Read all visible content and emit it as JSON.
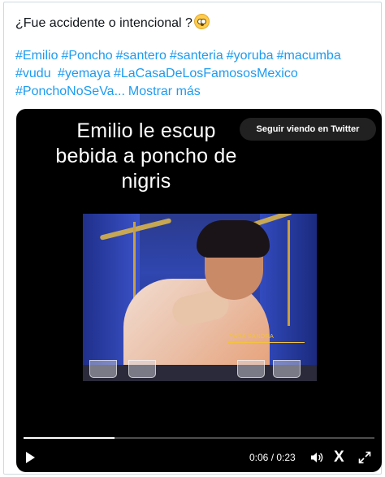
{
  "tweet": {
    "text": "¿Fue accidente o intencional ?",
    "emoji": "flushed-face-emoji",
    "hashtags": [
      "#Emilio",
      "#Poncho",
      "#santero",
      "#santeria",
      "#yoruba",
      "#macumba",
      "#vudu",
      " #yemaya",
      "#LaCasaDeLosFamososMexico",
      "#PonchoNoSeVa..."
    ],
    "show_more": "Mostrar más"
  },
  "video": {
    "caption_lines": [
      "Emilio le escup",
      "bebida a poncho de",
      "nigris"
    ],
    "continue_label": "Seguir viendo en Twitter",
    "watermark": "CASA SANDRA",
    "time": "0:06 / 0:23",
    "progress": 0.26,
    "colors": {
      "accent": "#1d9bf0",
      "background": "#000000"
    },
    "icons": {
      "play": "play-icon",
      "volume": "volume-icon",
      "brand": "x-logo-icon",
      "expand": "expand-icon"
    },
    "brand_glyph": "X"
  }
}
